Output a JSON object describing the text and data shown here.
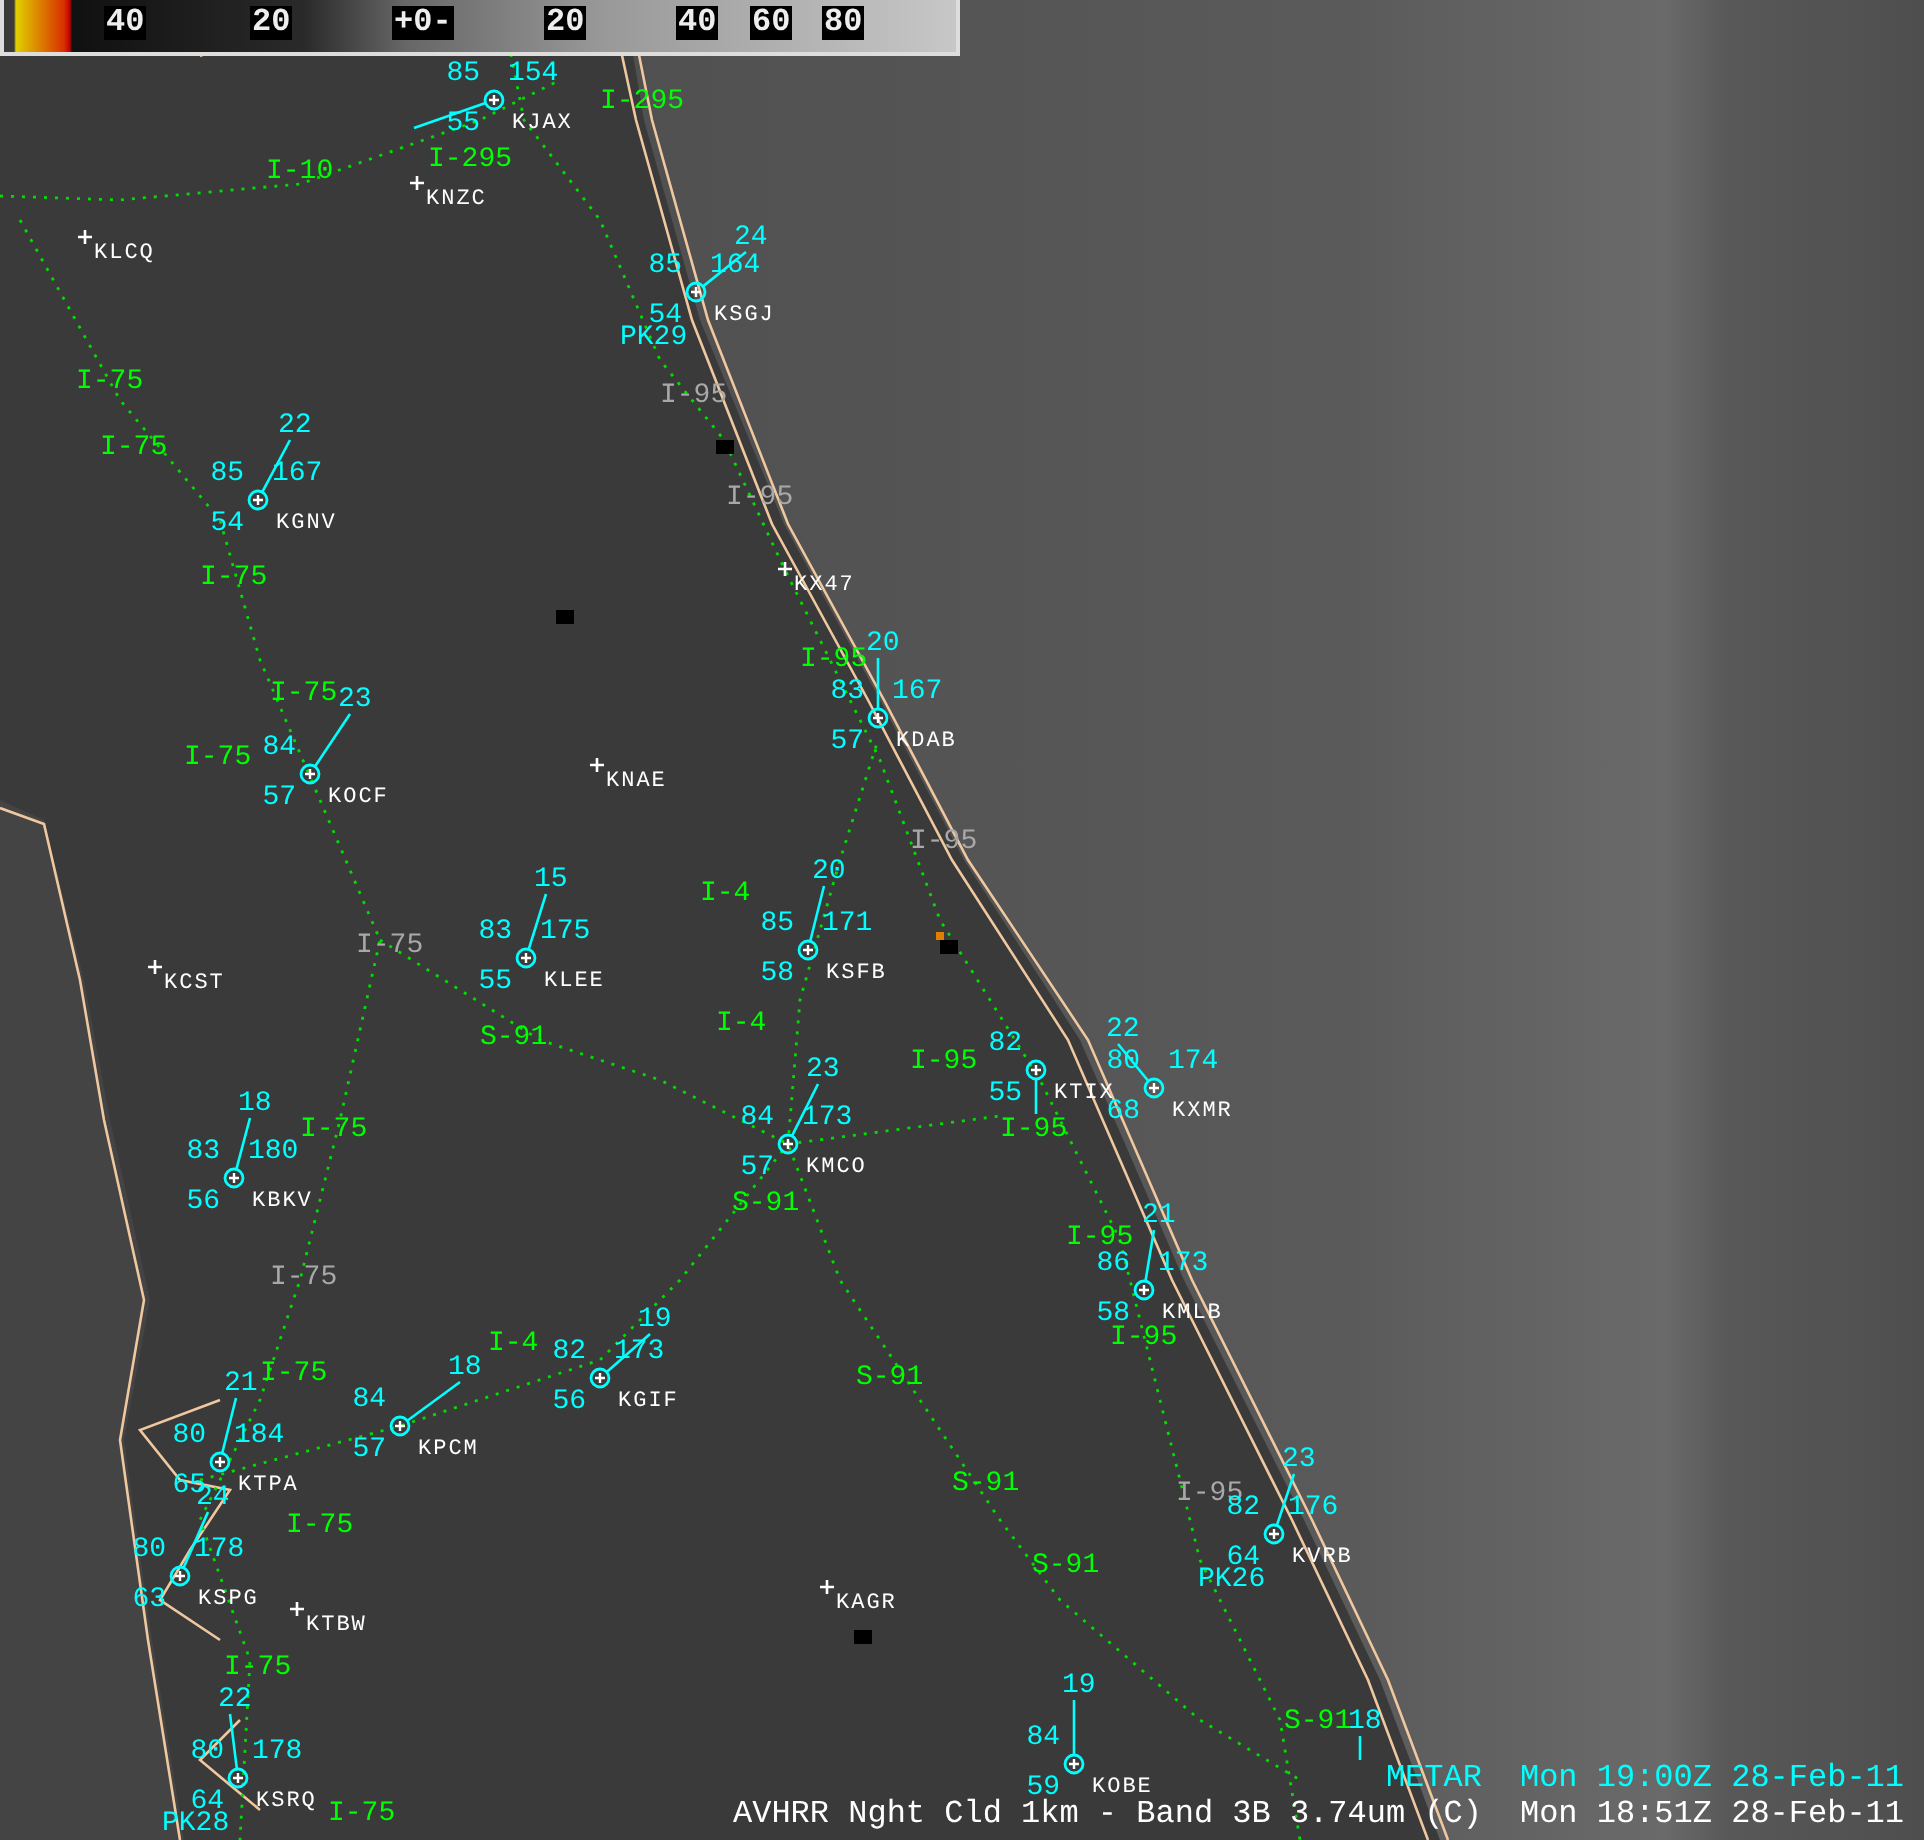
{
  "legend": {
    "ticks": [
      "40",
      "20",
      "+0-",
      "20",
      "40",
      "60",
      "80"
    ]
  },
  "stations": [
    {
      "kind": "metar",
      "id": "KJAX",
      "temp": "85",
      "dew": "55",
      "pressure": "154"
    },
    {
      "kind": "site",
      "id": "KNZC"
    },
    {
      "kind": "site",
      "id": "KLCQ"
    },
    {
      "kind": "metar",
      "id": "KSGJ",
      "temp": "85",
      "dew": "54",
      "pressure": "164",
      "wind": "24",
      "peak": "PK29"
    },
    {
      "kind": "metar",
      "id": "KGNV",
      "temp": "85",
      "dew": "54",
      "pressure": "167",
      "wind": "22"
    },
    {
      "kind": "site",
      "id": "KX47"
    },
    {
      "kind": "metar",
      "id": "KDAB",
      "temp": "83",
      "dew": "57",
      "pressure": "167",
      "wind": "20"
    },
    {
      "kind": "metar",
      "id": "KOCF",
      "temp": "84",
      "dew": "57",
      "wind": "23"
    },
    {
      "kind": "site",
      "id": "KNAE"
    },
    {
      "kind": "metar",
      "id": "KLEE",
      "temp": "83",
      "dew": "55",
      "pressure": "175",
      "wind": "15"
    },
    {
      "kind": "metar",
      "id": "KSFB",
      "temp": "85",
      "dew": "58",
      "pressure": "171",
      "wind": "20"
    },
    {
      "kind": "site",
      "id": "KCST"
    },
    {
      "kind": "metar",
      "id": "KTIX",
      "temp": "82",
      "dew": "55"
    },
    {
      "kind": "metar",
      "id": "KXMR",
      "temp": "80",
      "dew": "68",
      "pressure": "174",
      "wind": "22"
    },
    {
      "kind": "metar",
      "id": "KMCO",
      "temp": "84",
      "dew": "57",
      "pressure": "173",
      "wind": "23"
    },
    {
      "kind": "metar",
      "id": "KBKV",
      "temp": "83",
      "dew": "56",
      "pressure": "180",
      "wind": "18"
    },
    {
      "kind": "metar",
      "id": "KMLB",
      "temp": "86",
      "dew": "58",
      "pressure": "173",
      "wind": "21"
    },
    {
      "kind": "metar",
      "id": "KGIF",
      "temp": "82",
      "dew": "56",
      "pressure": "173",
      "wind": "19"
    },
    {
      "kind": "metar",
      "id": "KPCM",
      "temp": "84",
      "dew": "57",
      "wind": "18"
    },
    {
      "kind": "metar",
      "id": "KTPA",
      "temp": "80",
      "dew": "65",
      "pressure": "184",
      "wind": "21"
    },
    {
      "kind": "metar",
      "id": "KSPG",
      "temp": "80",
      "dew": "63",
      "pressure": "178",
      "wind": "24"
    },
    {
      "kind": "site",
      "id": "KTBW"
    },
    {
      "kind": "metar",
      "id": "KVRB",
      "temp": "82",
      "dew": "64",
      "pressure": "176",
      "wind": "23",
      "peak": "PK26"
    },
    {
      "kind": "site",
      "id": "KAGR"
    },
    {
      "kind": "metar",
      "id": "KSRQ",
      "temp": "80",
      "dew": "64",
      "pressure": "178",
      "wind": "22",
      "peak": "PK28"
    },
    {
      "kind": "metar",
      "id": "KOBE",
      "temp": "84",
      "dew": "59",
      "wind": "19"
    },
    {
      "kind": "partial",
      "wind": "18"
    }
  ],
  "highways": [
    {
      "label": "I-295",
      "dimmed": false
    },
    {
      "label": "I-295",
      "dimmed": false
    },
    {
      "label": "I-10",
      "dimmed": false
    },
    {
      "label": "I-75",
      "dimmed": false
    },
    {
      "label": "I-75",
      "dimmed": false
    },
    {
      "label": "I-75",
      "dimmed": false
    },
    {
      "label": "I-95",
      "dimmed": true
    },
    {
      "label": "I-95",
      "dimmed": true
    },
    {
      "label": "I-95",
      "dimmed": false
    },
    {
      "label": "I-75",
      "dimmed": false
    },
    {
      "label": "I-75",
      "dimmed": false
    },
    {
      "label": "I-95",
      "dimmed": true
    },
    {
      "label": "I-75",
      "dimmed": true
    },
    {
      "label": "I-4",
      "dimmed": false
    },
    {
      "label": "S-91",
      "dimmed": false
    },
    {
      "label": "I-4",
      "dimmed": false
    },
    {
      "label": "I-95",
      "dimmed": false
    },
    {
      "label": "I-95",
      "dimmed": false
    },
    {
      "label": "I-75",
      "dimmed": false
    },
    {
      "label": "S-91",
      "dimmed": false
    },
    {
      "label": "I-75",
      "dimmed": true
    },
    {
      "label": "I-95",
      "dimmed": false
    },
    {
      "label": "I-4",
      "dimmed": false
    },
    {
      "label": "I-75",
      "dimmed": false
    },
    {
      "label": "I-95",
      "dimmed": false
    },
    {
      "label": "S-91",
      "dimmed": false
    },
    {
      "label": "I-75",
      "dimmed": false
    },
    {
      "label": "S-91",
      "dimmed": false
    },
    {
      "label": "I-95",
      "dimmed": true
    },
    {
      "label": "S-91",
      "dimmed": false
    },
    {
      "label": "I-75",
      "dimmed": false
    },
    {
      "label": "I-75",
      "dimmed": false
    },
    {
      "label": "S-91",
      "dimmed": false
    }
  ],
  "caption": {
    "obs_source": "METAR",
    "obs_time": "Mon 19:00Z 28-Feb-11",
    "product": "AVHRR Nght Cld 1km - Band 3B 3.74um (C)",
    "image_time": "Mon 18:51Z 28-Feb-11"
  }
}
